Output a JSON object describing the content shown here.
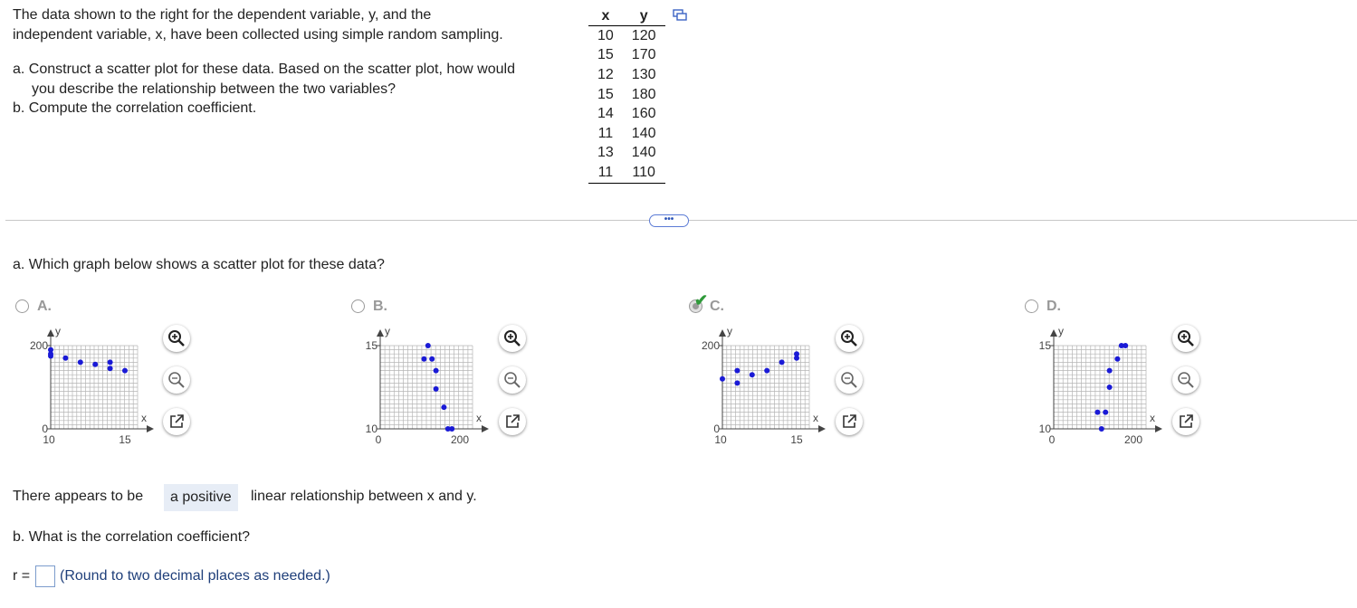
{
  "question": {
    "intro_line1": "The data shown to the right for the dependent variable, y, and the",
    "intro_line2": "independent variable, x, have been collected using simple random sampling.",
    "part_a_line1": "a. Construct a scatter plot for these data. Based on the scatter plot, how would",
    "part_a_line2": "you describe the relationship between the two variables?",
    "part_b": "b. Compute the correlation coefficient."
  },
  "data_table": {
    "headers": [
      "x",
      "y"
    ],
    "rows": [
      [
        10,
        120
      ],
      [
        15,
        170
      ],
      [
        12,
        130
      ],
      [
        15,
        180
      ],
      [
        14,
        160
      ],
      [
        11,
        140
      ],
      [
        13,
        140
      ],
      [
        11,
        110
      ]
    ]
  },
  "more_button": "•••",
  "part_a_prompt": "a. Which graph below shows a scatter plot for these data?",
  "options": [
    {
      "id": "A",
      "label": "A.",
      "selected": false,
      "correct": false
    },
    {
      "id": "B",
      "label": "B.",
      "selected": false,
      "correct": false
    },
    {
      "id": "C",
      "label": "C.",
      "selected": true,
      "correct": true
    },
    {
      "id": "D",
      "label": "D.",
      "selected": false,
      "correct": false
    }
  ],
  "chart_data": [
    {
      "type": "scatter",
      "option": "A",
      "xlabel": "x",
      "ylabel": "y",
      "xticks": [
        "10",
        "15"
      ],
      "yticks": [
        "0",
        "200"
      ],
      "points": [
        [
          10,
          190
        ],
        [
          10,
          180
        ],
        [
          10,
          175
        ],
        [
          11,
          170
        ],
        [
          12,
          160
        ],
        [
          13,
          155
        ],
        [
          14,
          160
        ],
        [
          14,
          145
        ],
        [
          15,
          140
        ]
      ]
    },
    {
      "type": "scatter",
      "option": "B",
      "xlabel": "x",
      "ylabel": "y",
      "xticks": [
        "0",
        "200"
      ],
      "yticks": [
        "10",
        "15"
      ],
      "points": [
        [
          120,
          15
        ],
        [
          110,
          14.2
        ],
        [
          130,
          14.2
        ],
        [
          140,
          13.5
        ],
        [
          140,
          12.4
        ],
        [
          160,
          11.3
        ],
        [
          170,
          10
        ],
        [
          180,
          10
        ]
      ]
    },
    {
      "type": "scatter",
      "option": "C",
      "xlabel": "x",
      "ylabel": "y",
      "xticks": [
        "10",
        "15"
      ],
      "yticks": [
        "0",
        "200"
      ],
      "points": [
        [
          10,
          120
        ],
        [
          11,
          110
        ],
        [
          11,
          140
        ],
        [
          12,
          130
        ],
        [
          13,
          140
        ],
        [
          14,
          160
        ],
        [
          15,
          170
        ],
        [
          15,
          180
        ]
      ]
    },
    {
      "type": "scatter",
      "option": "D",
      "xlabel": "x",
      "ylabel": "y",
      "xticks": [
        "0",
        "200"
      ],
      "yticks": [
        "10",
        "15"
      ],
      "points": [
        [
          120,
          10
        ],
        [
          110,
          11
        ],
        [
          130,
          11
        ],
        [
          140,
          12.5
        ],
        [
          140,
          13.5
        ],
        [
          160,
          14.2
        ],
        [
          170,
          15
        ],
        [
          180,
          15
        ]
      ]
    }
  ],
  "relationship": {
    "prefix": "There appears to be",
    "answer": "a positive",
    "suffix": "linear relationship between x and y."
  },
  "part_b_prompt": "b. What is the correlation coefficient?",
  "r_label": "r =",
  "r_value": "",
  "round_note": "(Round to two decimal places as needed.)"
}
